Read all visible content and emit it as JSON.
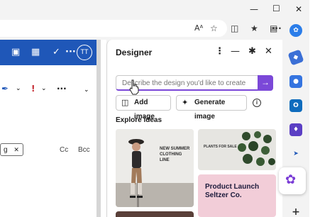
{
  "window": {
    "minimize_icon": "minimize-icon",
    "maximize_icon": "maximize-icon",
    "close_icon": "close-icon"
  },
  "browser_toolbar": {
    "read_aloud_label": "Aᴬ",
    "icons": [
      "read-aloud-icon",
      "favorite-icon",
      "split-screen-icon",
      "favorites-bar-icon",
      "collections-icon",
      "more-icon",
      "copilot-icon"
    ]
  },
  "email": {
    "avatar_initials": "TT",
    "more_label": "···",
    "recipient_chip": "g",
    "cc_label": "Cc",
    "bcc_label": "Bcc"
  },
  "designer": {
    "title": "Designer",
    "prompt_placeholder": "Describe the design you'd like to create",
    "add_image_label": "Add image",
    "generate_image_label": "Generate image",
    "explore_ideas_label": "Explore ideas",
    "cards": [
      {
        "heading": "NEW SUMMER CLOTHING LINE"
      },
      {
        "heading": "PLANTS FOR SALE"
      },
      {
        "heading": "Product Launch Seltzer Co."
      }
    ]
  },
  "sidebar": {
    "icons": [
      "tag-icon",
      "copilot-icon",
      "outlook-icon",
      "games-icon",
      "send-icon",
      "designer-icon",
      "add-icon"
    ]
  },
  "colors": {
    "accent": "#7b48d8",
    "app_bar": "#1f57b8",
    "card3_bg": "#f2cdd8"
  }
}
